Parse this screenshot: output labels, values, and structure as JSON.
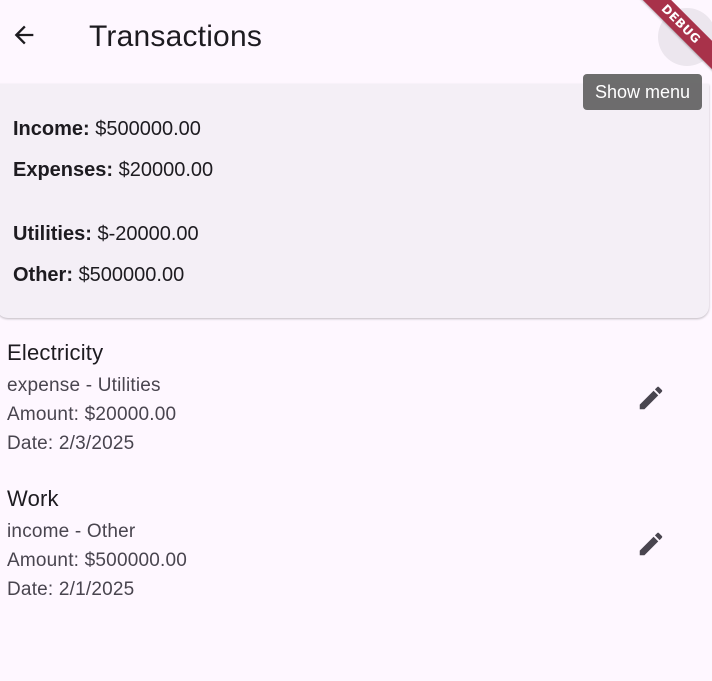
{
  "appbar": {
    "title": "Transactions",
    "back_icon": "arrow-back-icon",
    "menu_icon": "more-vert-icon"
  },
  "debug_banner": "DEBUG",
  "tooltip": "Show menu",
  "summary": {
    "income_label": "Income:",
    "income_value": "$500000.00",
    "expenses_label": "Expenses:",
    "expenses_value": "$20000.00",
    "utilities_label": "Utilities:",
    "utilities_value": "$-20000.00",
    "other_label": "Other:",
    "other_value": "$500000.00"
  },
  "transactions": [
    {
      "name": "Electricity",
      "type_category": "expense - Utilities",
      "amount": "Amount: $20000.00",
      "date": "Date: 2/3/2025",
      "edit_icon": "edit-icon"
    },
    {
      "name": "Work",
      "type_category": "income - Other",
      "amount": "Amount: $500000.00",
      "date": "Date: 2/1/2025",
      "edit_icon": "edit-icon"
    }
  ],
  "colors": {
    "background": "#fef7ff",
    "card": "#f4eff6",
    "ribbon": "#a8324a",
    "tooltip": "#616161",
    "icon": "#49454f"
  }
}
